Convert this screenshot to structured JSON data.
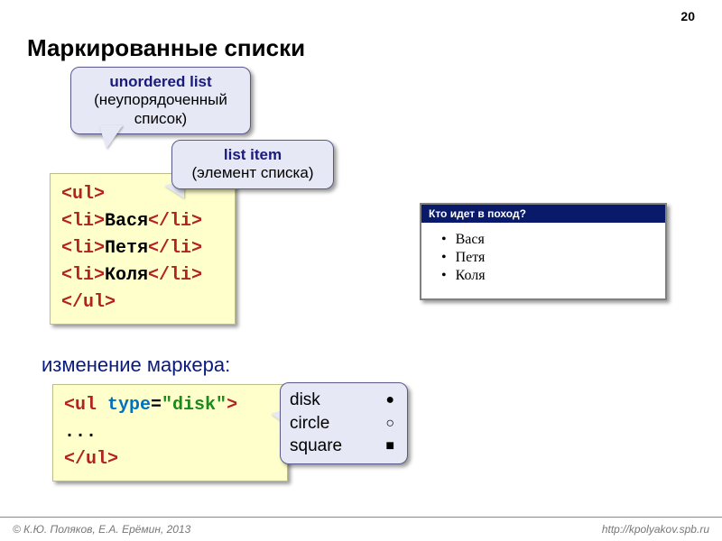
{
  "page_number": "20",
  "title": "Маркированные списки",
  "callout1": {
    "bold": "unordered list",
    "sub": "(неупорядоченный список)"
  },
  "callout2": {
    "bold": "list item",
    "sub": "(элемент списка)"
  },
  "code1": {
    "l1_open": "<ul>",
    "l2_open": "<li>",
    "l2_txt": "Вася",
    "l2_close": "</li>",
    "l3_open": "<li>",
    "l3_txt": "Петя",
    "l3_close": "</li>",
    "l4_open": "<li>",
    "l4_txt": "Коля",
    "l4_close": "</li>",
    "l5_close": "</ul>"
  },
  "browser": {
    "title": "Кто идет в поход?",
    "items": [
      "Вася",
      "Петя",
      "Коля"
    ]
  },
  "subhead": "изменение маркера:",
  "code2": {
    "open_tag": "<ul ",
    "attr": "type",
    "eq": "=",
    "val": "\"disk\"",
    "gt": ">",
    "dots": "...",
    "close": "</ul>"
  },
  "markers": {
    "r1_label": "disk",
    "r1_sym": "●",
    "r2_label": "circle",
    "r2_sym": "○",
    "r3_label": "square",
    "r3_sym": "■"
  },
  "footer": {
    "left": "© К.Ю. Поляков, Е.А. Ерёмин, 2013",
    "right": "http://kpolyakov.spb.ru"
  }
}
